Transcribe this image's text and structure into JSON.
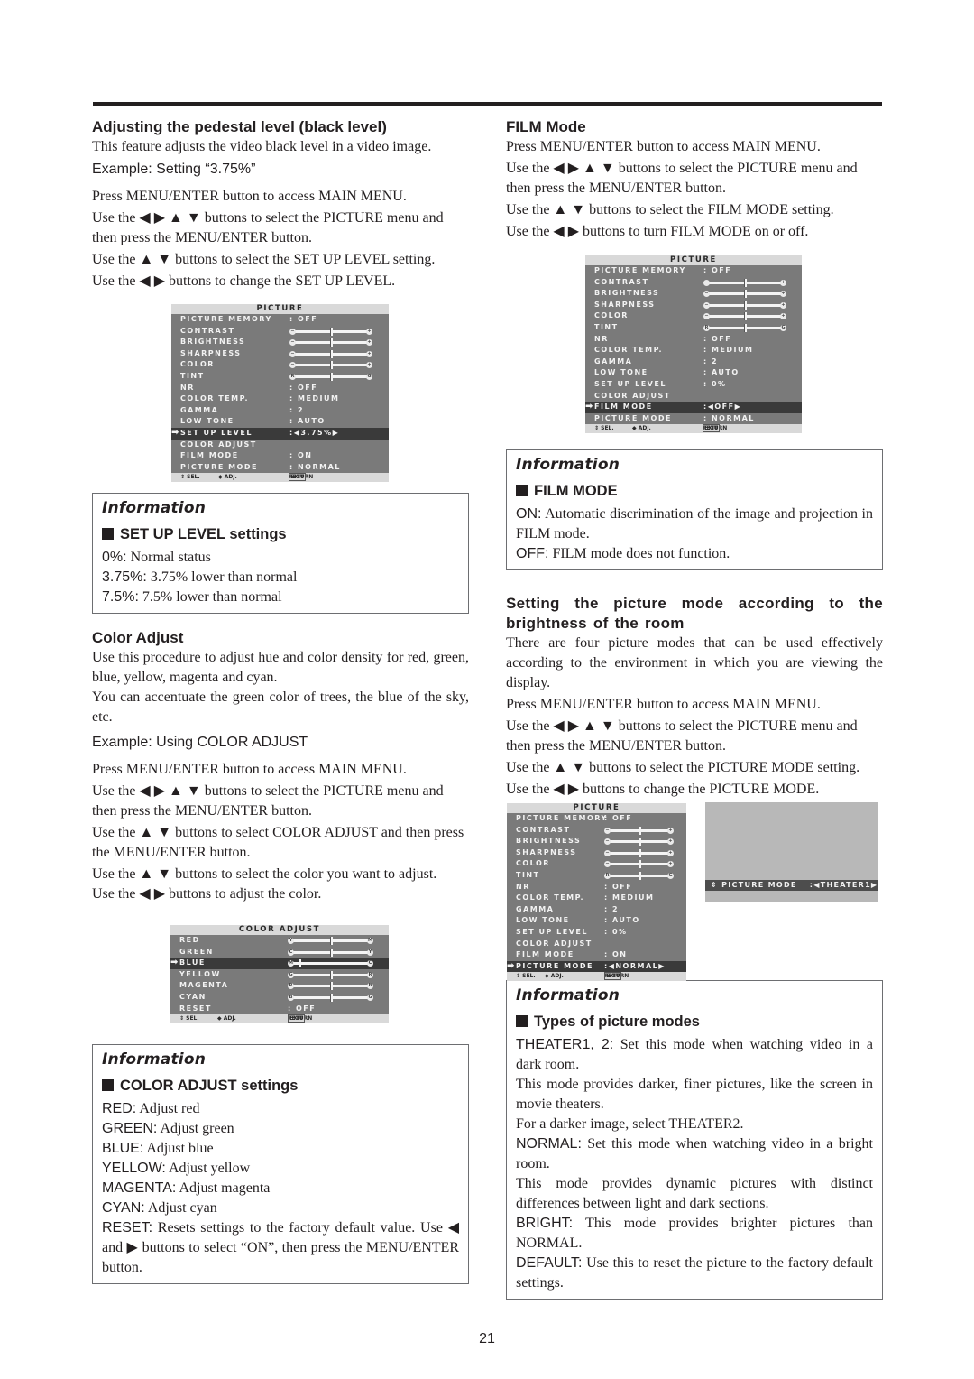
{
  "page_number": "21",
  "left": {
    "pedestal": {
      "heading": "Adjusting the pedestal level (black level)",
      "intro": "This feature adjusts the video black level in a video image.",
      "example": "Example: Setting “3.75%”",
      "steps": [
        "Press MENU/ENTER button to access MAIN MENU.",
        "Use the ◀ ▶ ▲ ▼ buttons to select the PICTURE menu and then press the MENU/ENTER button.",
        "Use the ▲ ▼ buttons to select the SET UP LEVEL setting.",
        "Use the ◀ ▶ buttons to change the SET UP LEVEL."
      ]
    },
    "info_setup": {
      "title": "Information",
      "heading": "SET UP LEVEL settings",
      "items": [
        {
          "key": "0%:",
          "text": " Normal status"
        },
        {
          "key": "3.75%:",
          "text": " 3.75% lower than normal"
        },
        {
          "key": "7.5%:",
          "text": " 7.5% lower than normal"
        }
      ]
    },
    "color_adjust": {
      "heading": "Color Adjust",
      "intro1": "Use this procedure to adjust hue and color density for red, green, blue, yellow, magenta and cyan.",
      "intro2": "You can accentuate the green color of trees, the blue of the sky, etc.",
      "example": "Example: Using COLOR ADJUST",
      "steps": [
        "Press MENU/ENTER button to access MAIN MENU.",
        "Use the ◀ ▶ ▲ ▼ buttons to select the PICTURE menu and then press the MENU/ENTER button.",
        "Use the ▲ ▼ buttons to select COLOR ADJUST and then press the MENU/ENTER button.",
        "Use the ▲ ▼ buttons to select the color you want to adjust.",
        "Use the ◀ ▶ buttons to adjust the color."
      ]
    },
    "info_color": {
      "title": "Information",
      "heading": "COLOR ADJUST settings",
      "items": [
        {
          "key": "RED:",
          "text": " Adjust red"
        },
        {
          "key": "GREEN:",
          "text": " Adjust green"
        },
        {
          "key": "BLUE:",
          "text": "  Adjust blue"
        },
        {
          "key": "YELLOW:",
          "text": " Adjust yellow"
        },
        {
          "key": "MAGENTA:",
          "text": " Adjust magenta"
        },
        {
          "key": "CYAN:",
          "text": " Adjust cyan"
        },
        {
          "key": "RESET:",
          "text": " Resets settings to the factory default value. Use  ◀ and ▶ buttons to select “ON”, then press the MENU/ENTER button."
        }
      ]
    }
  },
  "right": {
    "film": {
      "heading": "FILM Mode",
      "steps": [
        "Press MENU/ENTER button to access MAIN MENU.",
        "Use the ◀ ▶ ▲ ▼ buttons to select the PICTURE menu and then press the MENU/ENTER button.",
        "Use the ▲ ▼ buttons to select the FILM MODE setting.",
        "Use the ◀ ▶ buttons to turn FILM MODE on or off."
      ]
    },
    "info_film": {
      "title": "Information",
      "heading": "FILM MODE",
      "items": [
        {
          "key": "ON:",
          "text": " Automatic discrimination of the image and projection in FILM mode."
        },
        {
          "key": "OFF:",
          "text": " FILM mode does not function."
        }
      ]
    },
    "picture_mode": {
      "heading": "Setting the picture mode according to the brightness of the room",
      "intro": "There are four picture modes that can be used effectively according to the environment in which you are viewing the display.",
      "steps": [
        "Press MENU/ENTER button to access MAIN MENU.",
        "Use the ◀ ▶ ▲ ▼ buttons to select the PICTURE menu and then press the MENU/ENTER button.",
        "Use the ▲ ▼ buttons to select the PICTURE MODE setting.",
        "Use the ◀ ▶ buttons to change the PICTURE MODE."
      ],
      "screen_bar": {
        "label": "PICTURE MODE",
        "value": ":◀THEATER1▶"
      }
    },
    "info_modes": {
      "title": "Information",
      "heading": "Types of picture modes",
      "items": [
        {
          "key": "THEATER1, 2:",
          "text": " Set this mode when watching video in a dark room."
        },
        {
          "key": "",
          "text": "This mode provides darker, finer pictures, like the screen in movie theaters."
        },
        {
          "key": "",
          "text": "For a darker image, select THEATER2."
        },
        {
          "key": "NORMAL:",
          "text": " Set this mode when watching video in a bright room."
        },
        {
          "key": "",
          "text": "This mode provides dynamic pictures with distinct differences between light and dark sections."
        },
        {
          "key": "BRIGHT:",
          "text": " This mode provides brighter pictures than NORMAL."
        },
        {
          "key": "DEFAULT:",
          "text": " Use this to reset the picture to the factory default settings."
        }
      ]
    }
  },
  "osd": {
    "footer": {
      "sel": "SEL.",
      "adj": "ADJ.",
      "exit": "EXIT",
      "ret": "RETURN"
    },
    "picture_menus": [
      {
        "title": "PICTURE",
        "selected": "SET UP LEVEL",
        "rows": [
          {
            "label": "PICTURE MEMORY",
            "value": ":  OFF"
          },
          {
            "label": "CONTRAST",
            "slider": {
              "left": "−",
              "right": "+",
              "level": 0.5
            }
          },
          {
            "label": "BRIGHTNESS",
            "slider": {
              "left": "−",
              "right": "+",
              "level": 0.5
            }
          },
          {
            "label": "SHARPNESS",
            "slider": {
              "left": "−",
              "right": "+",
              "level": 0.5
            }
          },
          {
            "label": "COLOR",
            "slider": {
              "left": "−",
              "right": "+",
              "level": 0.5
            }
          },
          {
            "label": "TINT",
            "slider": {
              "left": "R",
              "right": "G",
              "level": 0.5
            }
          },
          {
            "label": "NR",
            "value": ":  OFF"
          },
          {
            "label": "COLOR TEMP.",
            "value": ":  MEDIUM"
          },
          {
            "label": "GAMMA",
            "value": ":  2"
          },
          {
            "label": "LOW TONE",
            "value": ":  AUTO"
          },
          {
            "label": "SET UP LEVEL",
            "value": ":◀3.75%▶"
          },
          {
            "label": "COLOR ADJUST",
            "value": ""
          },
          {
            "label": "FILM MODE",
            "value": ":  ON"
          },
          {
            "label": "PICTURE MODE",
            "value": ":  NORMAL"
          }
        ]
      },
      {
        "title": "PICTURE",
        "selected": "FILM MODE",
        "rows": [
          {
            "label": "PICTURE MEMORY",
            "value": ":  OFF"
          },
          {
            "label": "CONTRAST",
            "slider": {
              "left": "−",
              "right": "+",
              "level": 0.5
            }
          },
          {
            "label": "BRIGHTNESS",
            "slider": {
              "left": "−",
              "right": "+",
              "level": 0.5
            }
          },
          {
            "label": "SHARPNESS",
            "slider": {
              "left": "−",
              "right": "+",
              "level": 0.5
            }
          },
          {
            "label": "COLOR",
            "slider": {
              "left": "−",
              "right": "+",
              "level": 0.5
            }
          },
          {
            "label": "TINT",
            "slider": {
              "left": "R",
              "right": "G",
              "level": 0.5
            }
          },
          {
            "label": "NR",
            "value": ":  OFF"
          },
          {
            "label": "COLOR TEMP.",
            "value": ":  MEDIUM"
          },
          {
            "label": "GAMMA",
            "value": ":  2"
          },
          {
            "label": "LOW TONE",
            "value": ":  AUTO"
          },
          {
            "label": "SET UP LEVEL",
            "value": ":  0%"
          },
          {
            "label": "COLOR ADJUST",
            "value": ""
          },
          {
            "label": "FILM MODE",
            "value": ":◀OFF▶"
          },
          {
            "label": "PICTURE MODE",
            "value": ":  NORMAL"
          }
        ]
      },
      {
        "title": "PICTURE",
        "selected": "PICTURE MODE",
        "rows": [
          {
            "label": "PICTURE MEMORY",
            "value": ":  OFF"
          },
          {
            "label": "CONTRAST",
            "slider": {
              "left": "−",
              "right": "+",
              "level": 0.5
            }
          },
          {
            "label": "BRIGHTNESS",
            "slider": {
              "left": "−",
              "right": "+",
              "level": 0.5
            }
          },
          {
            "label": "SHARPNESS",
            "slider": {
              "left": "−",
              "right": "+",
              "level": 0.5
            }
          },
          {
            "label": "COLOR",
            "slider": {
              "left": "−",
              "right": "+",
              "level": 0.5
            }
          },
          {
            "label": "TINT",
            "slider": {
              "left": "R",
              "right": "G",
              "level": 0.5
            }
          },
          {
            "label": "NR",
            "value": ":  OFF"
          },
          {
            "label": "COLOR TEMP.",
            "value": ":  MEDIUM"
          },
          {
            "label": "GAMMA",
            "value": ":  2"
          },
          {
            "label": "LOW TONE",
            "value": ":  AUTO"
          },
          {
            "label": "SET UP LEVEL",
            "value": ":  0%"
          },
          {
            "label": "COLOR ADJUST",
            "value": ""
          },
          {
            "label": "FILM MODE",
            "value": ":  ON"
          },
          {
            "label": "PICTURE MODE",
            "value": ":◀NORMAL▶"
          }
        ]
      }
    ],
    "color_menu": {
      "title": "COLOR ADJUST",
      "selected": "BLUE",
      "rows": [
        {
          "label": "RED",
          "slider": {
            "left": "Y",
            "right": "M",
            "level": 0.5
          }
        },
        {
          "label": "GREEN",
          "slider": {
            "left": "C",
            "right": "Y",
            "level": 0.5
          }
        },
        {
          "label": "BLUE",
          "slider": {
            "left": "M",
            "right": "C",
            "level": 0.08
          }
        },
        {
          "label": "YELLOW",
          "slider": {
            "left": "G",
            "right": "R",
            "level": 0.5
          }
        },
        {
          "label": "MAGENTA",
          "slider": {
            "left": "R",
            "right": "B",
            "level": 0.5
          }
        },
        {
          "label": "CYAN",
          "slider": {
            "left": "B",
            "right": "G",
            "level": 0.5
          }
        },
        {
          "label": "RESET",
          "value": ":  OFF"
        }
      ]
    }
  }
}
